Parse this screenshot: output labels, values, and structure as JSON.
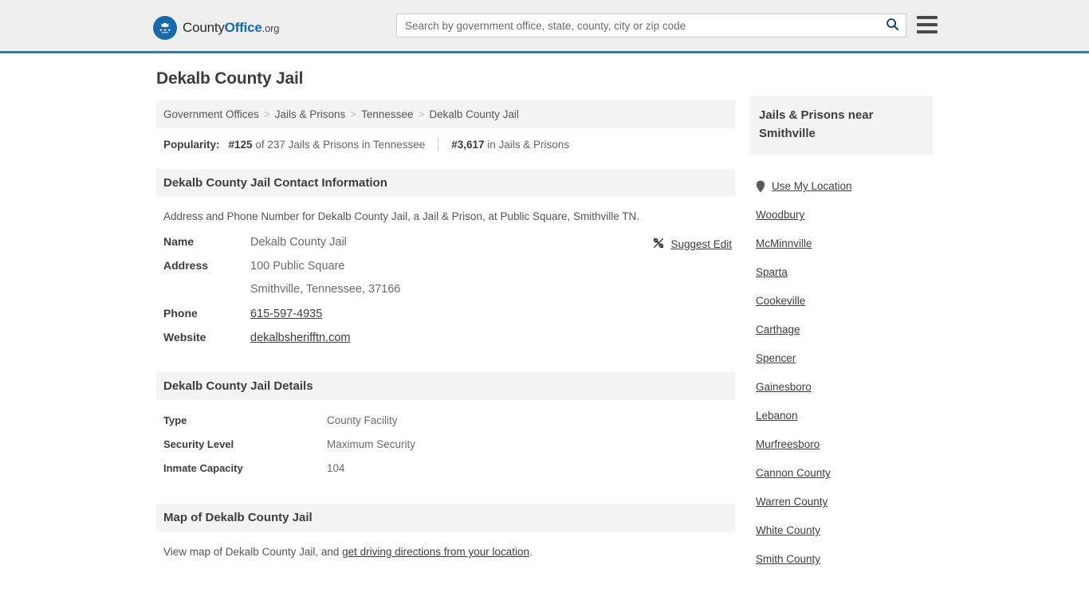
{
  "header": {
    "logo_text_county": "County",
    "logo_text_office": "Office",
    "logo_text_tld": ".org",
    "logo_icon": "eagle-stars-emblem",
    "search_placeholder": "Search by government office, state, county, city or zip code",
    "search_value": "",
    "search_icon": "search-icon",
    "menu_icon": "hamburger-menu-icon",
    "accent_color": "#1769aa",
    "border_color": "#3a7ca8"
  },
  "main": {
    "page_title": "Dekalb County Jail",
    "breadcrumb": [
      "Government Offices",
      "Jails & Prisons",
      "Tennessee",
      "Dekalb County Jail"
    ],
    "breadcrumb_separator": ">",
    "popularity": {
      "label": "Popularity:",
      "rank_state": "#125",
      "rank_state_suffix": "of 237 Jails & Prisons in Tennessee",
      "rank_national": "#3,617",
      "rank_national_suffix": "in Jails & Prisons"
    },
    "contact": {
      "section_title": "Dekalb County Jail Contact Information",
      "intro": "Address and Phone Number for Dekalb County Jail, a Jail & Prison, at Public Square, Smithville TN.",
      "suggest_edit_label": "Suggest Edit",
      "suggest_edit_icon": "edit-pencil-icon",
      "rows": [
        {
          "key": "Name",
          "value": "Dekalb County Jail",
          "link": false
        },
        {
          "key": "Address",
          "value": "100 Public Square",
          "link": false
        },
        {
          "key": "",
          "value": "Smithville, Tennessee, 37166",
          "link": false
        },
        {
          "key": "Phone",
          "value": "615-597-4935",
          "link": true
        },
        {
          "key": "Website",
          "value": "dekalbsherifftn.com",
          "link": true
        }
      ]
    },
    "details": {
      "section_title": "Dekalb County Jail Details",
      "rows": [
        {
          "key": "Type",
          "value": "County Facility"
        },
        {
          "key": "Security Level",
          "value": "Maximum Security"
        },
        {
          "key": "Inmate Capacity",
          "value": "104"
        }
      ]
    },
    "map": {
      "section_title": "Map of Dekalb County Jail",
      "text_before": "View map of Dekalb County Jail, and ",
      "link_text": "get driving directions from your location",
      "text_after": "."
    }
  },
  "sidebar": {
    "title": "Jails & Prisons near Smithville",
    "location_icon": "map-pin-icon",
    "items": [
      {
        "label": "Use My Location",
        "icon": "map-pin-icon"
      },
      {
        "label": "Woodbury"
      },
      {
        "label": "McMinnville"
      },
      {
        "label": "Sparta"
      },
      {
        "label": "Cookeville"
      },
      {
        "label": "Carthage"
      },
      {
        "label": "Spencer"
      },
      {
        "label": "Gainesboro"
      },
      {
        "label": "Lebanon"
      },
      {
        "label": "Murfreesboro"
      },
      {
        "label": "Cannon County"
      },
      {
        "label": "Warren County"
      },
      {
        "label": "White County"
      },
      {
        "label": "Smith County"
      }
    ]
  }
}
